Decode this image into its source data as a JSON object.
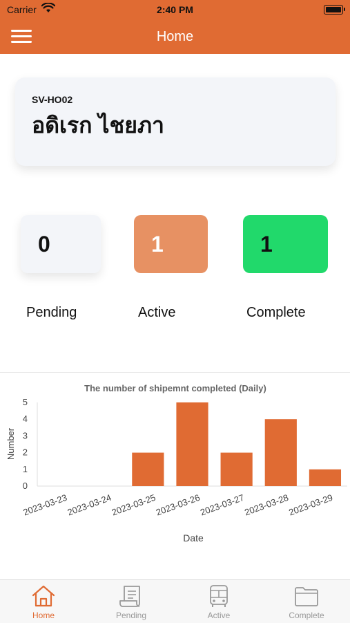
{
  "status_bar": {
    "carrier": "Carrier",
    "time": "2:40 PM"
  },
  "nav": {
    "title": "Home",
    "menu_icon": "hamburger-menu-icon"
  },
  "user": {
    "code": "SV-HO02",
    "name": "อดิเรก ไชยภา"
  },
  "stats": {
    "pending": {
      "value": "0",
      "label": "Pending"
    },
    "active": {
      "value": "1",
      "label": "Active"
    },
    "complete": {
      "value": "1",
      "label": "Complete"
    }
  },
  "colors": {
    "accent": "#e06b33",
    "active_box": "#e79163",
    "complete_box": "#21d96b",
    "bar": "#e06b33"
  },
  "chart_data": {
    "type": "bar",
    "title": "The number of shipemnt completed (Daily)",
    "xlabel": "Date",
    "ylabel": "Number",
    "categories": [
      "2023-03-23",
      "2023-03-24",
      "2023-03-25",
      "2023-03-26",
      "2023-03-27",
      "2023-03-28",
      "2023-03-29"
    ],
    "values": [
      0,
      0,
      2,
      5,
      2,
      4,
      1
    ],
    "ylim": [
      0,
      5
    ],
    "yticks": [
      "0",
      "1",
      "2",
      "3",
      "4",
      "5"
    ],
    "grid": false,
    "legend": "none"
  },
  "tabs": [
    {
      "label": "Home",
      "icon": "home-icon",
      "active": true
    },
    {
      "label": "Pending",
      "icon": "receipt-icon",
      "active": false
    },
    {
      "label": "Active",
      "icon": "bus-icon",
      "active": false
    },
    {
      "label": "Complete",
      "icon": "folder-icon",
      "active": false
    }
  ]
}
